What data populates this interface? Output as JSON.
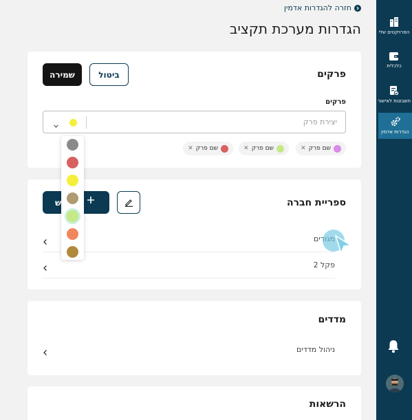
{
  "back_link": "חזרה להגדרות אדמין",
  "page_title": "הגדרות מערכת תקציב",
  "sidebar": {
    "items": [
      {
        "label": "הפרויקטים שלי",
        "icon": "buildings-icon"
      },
      {
        "label": "כלכלית",
        "icon": "wallet-icon"
      },
      {
        "label": "חשבונות לאישור",
        "icon": "invoice-check-icon"
      },
      {
        "label": "הגדרות אדמין",
        "icon": "gears-icon",
        "active": true
      }
    ],
    "bell_icon": "bell-icon",
    "avatar": "user-avatar"
  },
  "chapters_card": {
    "title": "פרקים",
    "save_label": "שמירה",
    "cancel_label": "ביטול",
    "field_label": "פרקים",
    "placeholder": "יצירת פרק",
    "selected_color": "#f5ef3c",
    "tags": [
      {
        "label": "שם פרק",
        "color": "#d98be8"
      },
      {
        "label": "שם פרק",
        "color": "#c7e887"
      },
      {
        "label": "שם פרק",
        "color": "#d96060"
      }
    ]
  },
  "palette": {
    "colors": [
      "#8a8a8a",
      "#d96060",
      "#f5ef3c",
      "#b09a72",
      "#c7e887",
      "#f2855a",
      "#b08a3c"
    ],
    "selected_index": 4
  },
  "library_card": {
    "title": "ספריית חברה",
    "add_label": "ש",
    "rows": [
      {
        "label": "מגורים"
      },
      {
        "label": "פקל 2"
      }
    ]
  },
  "indices_card": {
    "title": "מדדים",
    "rows": [
      {
        "label": "ניהול מדדים"
      }
    ]
  },
  "permissions_card": {
    "title": "הרשאות"
  }
}
